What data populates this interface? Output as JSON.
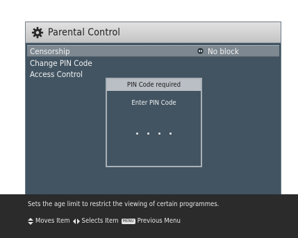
{
  "window": {
    "title": "Parental Control",
    "title_icon": "gear-icon"
  },
  "menu": {
    "items": [
      {
        "label": "Censorship",
        "value": "No block",
        "selected": true
      },
      {
        "label": "Change PIN Code"
      },
      {
        "label": "Access Control"
      }
    ]
  },
  "dialog": {
    "title": "PIN Code required",
    "prompt": "Enter PIN Code",
    "pin_placeholder": "• • • •"
  },
  "footer": {
    "help_text": "Sets the age limit to restrict the viewing of certain programmes.",
    "keys": [
      {
        "icon": "up-down-arrow-icon",
        "label": "Moves Item"
      },
      {
        "icon": "left-right-arrow-icon",
        "label": "Selects Item"
      },
      {
        "icon": "menu-key-icon",
        "key_text": "MENU",
        "label": "Previous Menu"
      }
    ]
  },
  "colors": {
    "panel_bg": "#425462",
    "header_bg": "#d4d4d4",
    "selected_row_bg": "#7d8891",
    "footer_bg": "#2b2b2b"
  }
}
